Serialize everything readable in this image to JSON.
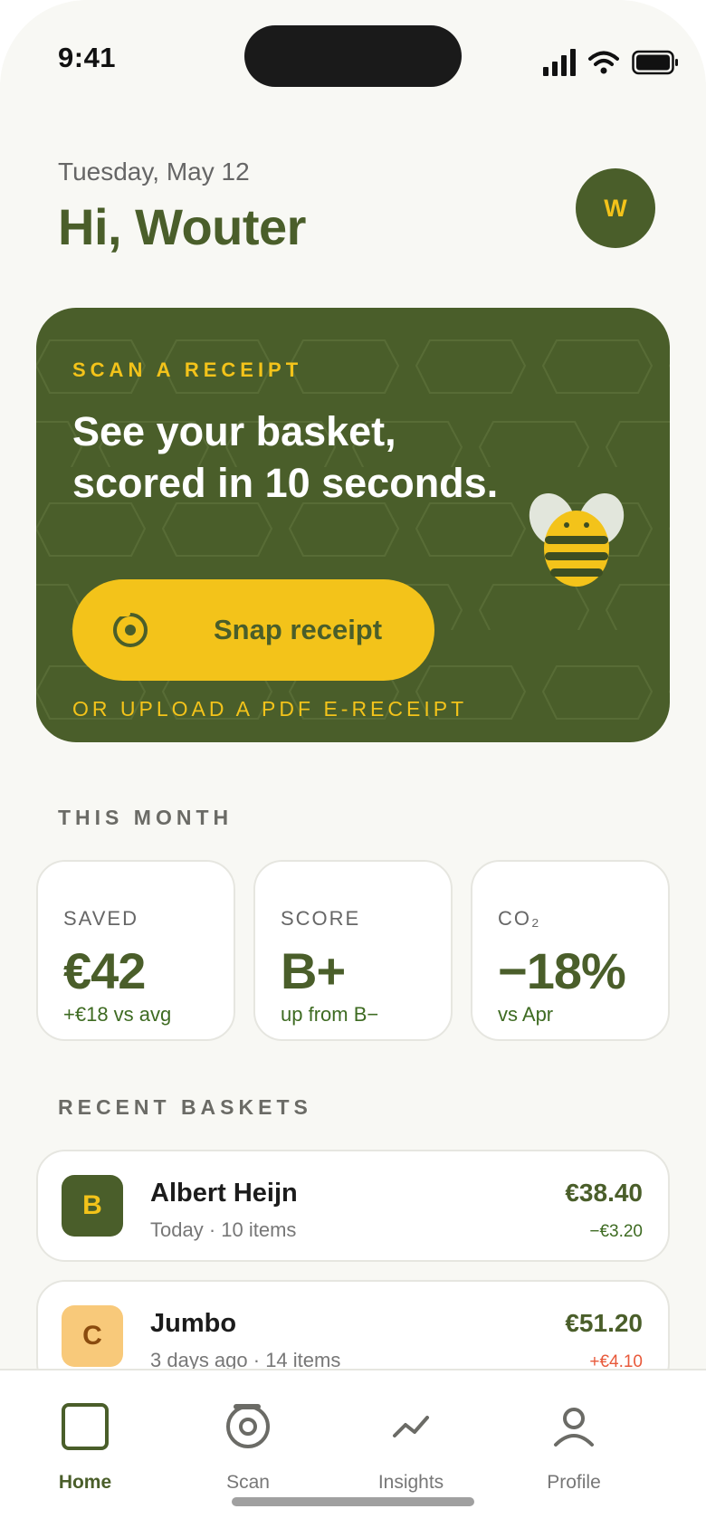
{
  "status_bar": {
    "time": "9:41",
    "icons": [
      "signal-icon",
      "wifi-icon",
      "battery-icon"
    ]
  },
  "header": {
    "date": "Tuesday, May 12",
    "greeting": "Hi, Wouter",
    "avatar_initial": "W"
  },
  "hero": {
    "eyebrow": "SCAN A RECEIPT",
    "title_line1": "See your basket,",
    "title_line2": "scored in 10 seconds.",
    "button_label": "Snap receipt",
    "upload_text": "OR UPLOAD A PDF E-RECEIPT"
  },
  "this_month": {
    "label": "THIS MONTH",
    "stats": [
      {
        "label": "SAVED",
        "value": "€42",
        "sub": "+€18 vs avg"
      },
      {
        "label": "SCORE",
        "value": "B+",
        "sub": "up from B−"
      },
      {
        "label": "CO₂",
        "value": "−18%",
        "sub": "vs Apr"
      }
    ]
  },
  "recent_baskets": {
    "label": "RECENT BASKETS",
    "items": [
      {
        "grade": "B",
        "store": "Albert Heijn",
        "meta": "Today · 10 items",
        "amount": "€38.40",
        "delta": "−€3.20"
      },
      {
        "grade": "C",
        "store": "Jumbo",
        "meta": "3 days ago · 14 items",
        "amount": "€51.20",
        "delta": "+€4.10"
      }
    ]
  },
  "tabs": [
    {
      "label": "Home",
      "icon": "home-icon",
      "active": true
    },
    {
      "label": "Scan",
      "icon": "scan-icon",
      "active": false
    },
    {
      "label": "Insights",
      "icon": "insights-icon",
      "active": false
    },
    {
      "label": "Profile",
      "icon": "profile-icon",
      "active": false
    }
  ],
  "colors": {
    "brand_green": "#4a5e2a",
    "accent_yellow": "#f3c31a",
    "positive": "#3e6b22",
    "negative": "#e8593a",
    "background": "#f8f8f4"
  }
}
